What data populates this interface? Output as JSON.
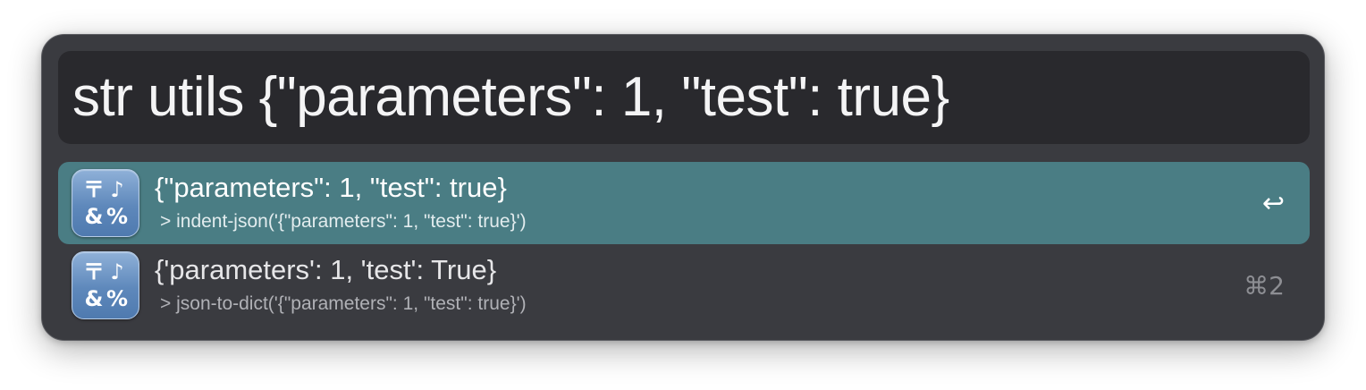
{
  "search": {
    "query": "str utils {\"parameters\": 1, \"test\": true}"
  },
  "results": [
    {
      "icon": {
        "name": "symbols-icon",
        "glyphs": [
          "〒",
          "♪",
          "&",
          "%"
        ]
      },
      "title": "{\"parameters\": 1, \"test\": true}",
      "subtitle": "> indent-json('{\"parameters\": 1, \"test\": true}')",
      "shortcut": "↩",
      "selected": true
    },
    {
      "icon": {
        "name": "symbols-icon",
        "glyphs": [
          "〒",
          "♪",
          "&",
          "%"
        ]
      },
      "title": "{'parameters': 1, 'test': True}",
      "subtitle": "> json-to-dict('{\"parameters\": 1, \"test\": true}')",
      "shortcut": "⌘2",
      "selected": false
    }
  ],
  "colors": {
    "window_bg": "#3a3b40",
    "search_bg": "#29292d",
    "selected_bg": "#4a7d84"
  }
}
